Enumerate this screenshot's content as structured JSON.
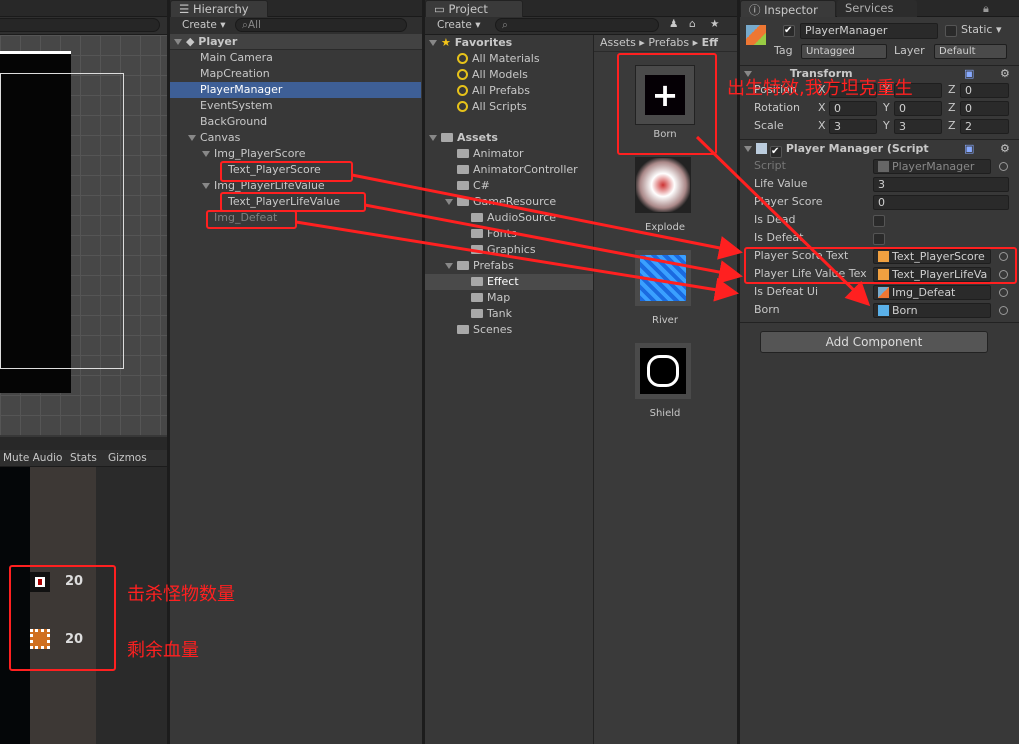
{
  "scene_view": {},
  "game_view": {
    "toolbar": {
      "mute_audio": "Mute Audio",
      "stats": "Stats",
      "gizmos": "Gizmos"
    },
    "hud": {
      "kill_count": "20",
      "life_count": "20"
    }
  },
  "hierarchy": {
    "tab": "Hierarchy",
    "create": "Create",
    "search_placeholder": "All",
    "scene": "Player",
    "items": [
      {
        "label": "Main Camera"
      },
      {
        "label": "MapCreation"
      },
      {
        "label": "PlayerManager",
        "selected": true
      },
      {
        "label": "EventSystem"
      },
      {
        "label": "BackGround"
      },
      {
        "label": "Canvas"
      },
      {
        "label": "Img_PlayerScore"
      },
      {
        "label": "Text_PlayerScore"
      },
      {
        "label": "Img_PlayerLifeValue"
      },
      {
        "label": "Text_PlayerLifeValue"
      },
      {
        "label": "Img_Defeat"
      }
    ]
  },
  "project": {
    "tab": "Project",
    "create": "Create",
    "favorites": {
      "label": "Favorites",
      "items": [
        "All Materials",
        "All Models",
        "All Prefabs",
        "All Scripts"
      ]
    },
    "assets": {
      "label": "Assets",
      "items": [
        "Animator",
        "AnimatorController",
        "C#",
        "GameResource",
        "AudioSource",
        "Fonts",
        "Graphics",
        "Prefabs",
        "Effect",
        "Map",
        "Tank",
        "Scenes"
      ]
    },
    "breadcrumb": [
      "Assets",
      "Prefabs",
      "Eff"
    ],
    "grid": [
      "Born",
      "Explode",
      "River",
      "Shield"
    ]
  },
  "inspector": {
    "tabs": [
      "Inspector",
      "Services"
    ],
    "object_name": "PlayerManager",
    "static_label": "Static",
    "tag_label": "Tag",
    "tag_value": "Untagged",
    "layer_label": "Layer",
    "layer_value": "Default",
    "transform": {
      "title": "Transform",
      "position": {
        "label": "Position",
        "z": "0"
      },
      "rotation": {
        "label": "Rotation",
        "x": "0",
        "y": "0",
        "z": "0"
      },
      "scale": {
        "label": "Scale",
        "x": "3",
        "y": "3",
        "z": "2"
      }
    },
    "script_component": {
      "title": "Player Manager (Script",
      "fields": [
        {
          "label": "Script",
          "value": "PlayerManager"
        },
        {
          "label": "Life Value",
          "value": "3"
        },
        {
          "label": "Player Score",
          "value": "0"
        },
        {
          "label": "Is Dead"
        },
        {
          "label": "Is Defeat"
        },
        {
          "label": "Player Score Text",
          "value": "Text_PlayerScore"
        },
        {
          "label": "Player Life Value Tex",
          "value": "Text_PlayerLifeVa"
        },
        {
          "label": "Is Defeat Ui",
          "value": "Img_Defeat"
        },
        {
          "label": "Born",
          "value": "Born"
        }
      ]
    },
    "add_component": "Add Component"
  },
  "annotations": {
    "born_note": "出生特效,我方坦克重生",
    "kill_note": "击杀怪物数量",
    "life_note": "剩余血量",
    "color": "#ff2020"
  }
}
